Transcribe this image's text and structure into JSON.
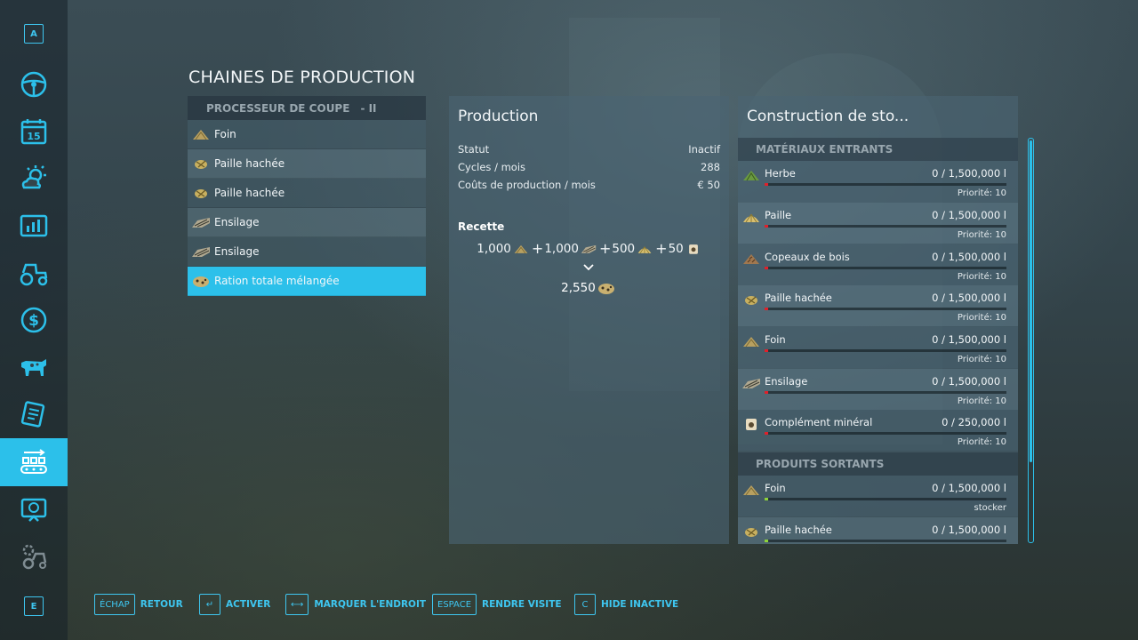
{
  "sidebar": {
    "top_key": "A",
    "bottom_key": "E",
    "items": [
      {
        "icon": "steering-wheel-icon"
      },
      {
        "icon": "calendar-icon",
        "text": "15"
      },
      {
        "icon": "weather-icon"
      },
      {
        "icon": "statistics-icon"
      },
      {
        "icon": "tractor-icon"
      },
      {
        "icon": "finances-icon"
      },
      {
        "icon": "animals-icon"
      },
      {
        "icon": "contracts-icon"
      },
      {
        "icon": "production-icon",
        "active": true
      },
      {
        "icon": "tutorial-icon"
      },
      {
        "icon": "settings-icon"
      }
    ]
  },
  "page_title": "CHAINES DE PRODUCTION",
  "chains": {
    "header": "PROCESSEUR DE COUPE",
    "tier": "- II",
    "items": [
      {
        "label": "Foin",
        "icon": "hay-icon"
      },
      {
        "label": "Paille hachée",
        "icon": "chopped-straw-icon"
      },
      {
        "label": "Paille hachée",
        "icon": "chopped-straw-icon"
      },
      {
        "label": "Ensilage",
        "icon": "silage-icon"
      },
      {
        "label": "Ensilage",
        "icon": "silage-icon"
      },
      {
        "label": "Ration totale mélangée",
        "icon": "tmr-icon",
        "selected": true
      }
    ]
  },
  "production": {
    "title": "Production",
    "status_label": "Statut",
    "status_value": "Inactif",
    "cycles_label": "Cycles / mois",
    "cycles_value": "288",
    "cost_label": "Coûts de production / mois",
    "cost_value": "€ 50",
    "recipe_label": "Recette",
    "recipe_inputs": [
      {
        "amount": "1,000",
        "icon": "hay-icon"
      },
      {
        "amount": "1,000",
        "icon": "silage-icon"
      },
      {
        "amount": "500",
        "icon": "straw-icon"
      },
      {
        "amount": "50",
        "icon": "mineral-feed-icon"
      }
    ],
    "recipe_plus": "+",
    "recipe_output": {
      "amount": "2,550",
      "icon": "tmr-icon"
    }
  },
  "storage": {
    "title": "Construction de sto...",
    "inputs_header": "MATÉRIAUX ENTRANTS",
    "outputs_header": "PRODUITS SORTANTS",
    "inputs": [
      {
        "name": "Herbe",
        "amount": "0  / 1,500,000 l",
        "sub": "Priorité: 10",
        "icon": "grass-icon",
        "fill": 0
      },
      {
        "name": "Paille",
        "amount": "0  / 1,500,000 l",
        "sub": "Priorité: 10",
        "icon": "straw-icon",
        "fill": 0
      },
      {
        "name": "Copeaux de bois",
        "amount": "0  / 1,500,000 l",
        "sub": "Priorité: 10",
        "icon": "woodchips-icon",
        "fill": 0
      },
      {
        "name": "Paille hachée",
        "amount": "0  / 1,500,000 l",
        "sub": "Priorité: 10",
        "icon": "chopped-straw-icon",
        "fill": 0
      },
      {
        "name": "Foin",
        "amount": "0  / 1,500,000 l",
        "sub": "Priorité: 10",
        "icon": "hay-icon",
        "fill": 0
      },
      {
        "name": "Ensilage",
        "amount": "0  / 1,500,000 l",
        "sub": "Priorité: 10",
        "icon": "silage-icon",
        "fill": 0
      },
      {
        "name": "Complément minéral",
        "amount": "0  / 250,000 l",
        "sub": "Priorité: 10",
        "icon": "mineral-feed-icon",
        "fill": 0
      }
    ],
    "outputs": [
      {
        "name": "Foin",
        "amount": "0  / 1,500,000 l",
        "sub": "stocker",
        "icon": "hay-icon",
        "fill": 0
      },
      {
        "name": "Paille hachée",
        "amount": "0  / 1,500,000 l",
        "sub": "",
        "icon": "chopped-straw-icon",
        "fill": 0
      }
    ],
    "input_bar_color": "#e0202a",
    "output_bar_color": "#8ed23a"
  },
  "hints": [
    {
      "key": "ÉCHAP",
      "label": "RETOUR"
    },
    {
      "key": "↵",
      "label": "ACTIVER"
    },
    {
      "key": "⟷",
      "label": "MARQUER L'ENDROIT"
    },
    {
      "key": "ESPACE",
      "label": "RENDRE VISITE"
    },
    {
      "key": "C",
      "label": "HIDE INACTIVE"
    }
  ],
  "colors": {
    "accent": "#2cc0ea"
  }
}
